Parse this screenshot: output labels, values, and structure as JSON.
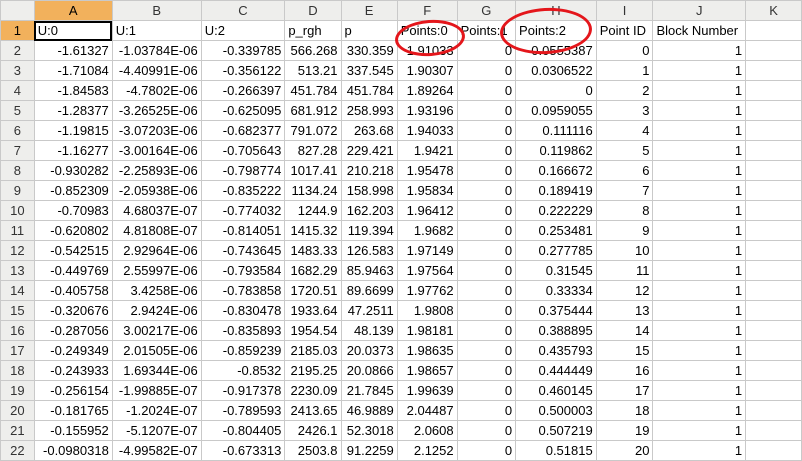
{
  "columns": [
    "A",
    "B",
    "C",
    "D",
    "E",
    "F",
    "G",
    "H",
    "I",
    "J",
    "K"
  ],
  "active_column": "A",
  "active_row": "1",
  "rows": [
    {
      "n": "1",
      "cells": [
        "U:0",
        "U:1",
        "U:2",
        "p_rgh",
        "p",
        "Points:0",
        "Points:1",
        "Points:2",
        "Point ID",
        "Block Number",
        ""
      ]
    },
    {
      "n": "2",
      "cells": [
        "-1.61327",
        "-1.03784E-06",
        "-0.339785",
        "566.268",
        "330.359",
        "1.91033",
        "0",
        "0.0555387",
        "0",
        "1",
        ""
      ]
    },
    {
      "n": "3",
      "cells": [
        "-1.71084",
        "-4.40991E-06",
        "-0.356122",
        "513.21",
        "337.545",
        "1.90307",
        "0",
        "0.0306522",
        "1",
        "1",
        ""
      ]
    },
    {
      "n": "4",
      "cells": [
        "-1.84583",
        "-4.7802E-06",
        "-0.266397",
        "451.784",
        "451.784",
        "1.89264",
        "0",
        "0",
        "2",
        "1",
        ""
      ]
    },
    {
      "n": "5",
      "cells": [
        "-1.28377",
        "-3.26525E-06",
        "-0.625095",
        "681.912",
        "258.993",
        "1.93196",
        "0",
        "0.0959055",
        "3",
        "1",
        ""
      ]
    },
    {
      "n": "6",
      "cells": [
        "-1.19815",
        "-3.07203E-06",
        "-0.682377",
        "791.072",
        "263.68",
        "1.94033",
        "0",
        "0.111116",
        "4",
        "1",
        ""
      ]
    },
    {
      "n": "7",
      "cells": [
        "-1.16277",
        "-3.00164E-06",
        "-0.705643",
        "827.28",
        "229.421",
        "1.9421",
        "0",
        "0.119862",
        "5",
        "1",
        ""
      ]
    },
    {
      "n": "8",
      "cells": [
        "-0.930282",
        "-2.25893E-06",
        "-0.798774",
        "1017.41",
        "210.218",
        "1.95478",
        "0",
        "0.166672",
        "6",
        "1",
        ""
      ]
    },
    {
      "n": "9",
      "cells": [
        "-0.852309",
        "-2.05938E-06",
        "-0.835222",
        "1134.24",
        "158.998",
        "1.95834",
        "0",
        "0.189419",
        "7",
        "1",
        ""
      ]
    },
    {
      "n": "10",
      "cells": [
        "-0.70983",
        "4.68037E-07",
        "-0.774032",
        "1244.9",
        "162.203",
        "1.96412",
        "0",
        "0.222229",
        "8",
        "1",
        ""
      ]
    },
    {
      "n": "11",
      "cells": [
        "-0.620802",
        "4.81808E-07",
        "-0.814051",
        "1415.32",
        "119.394",
        "1.9682",
        "0",
        "0.253481",
        "9",
        "1",
        ""
      ]
    },
    {
      "n": "12",
      "cells": [
        "-0.542515",
        "2.92964E-06",
        "-0.743645",
        "1483.33",
        "126.583",
        "1.97149",
        "0",
        "0.277785",
        "10",
        "1",
        ""
      ]
    },
    {
      "n": "13",
      "cells": [
        "-0.449769",
        "2.55997E-06",
        "-0.793584",
        "1682.29",
        "85.9463",
        "1.97564",
        "0",
        "0.31545",
        "11",
        "1",
        ""
      ]
    },
    {
      "n": "14",
      "cells": [
        "-0.405758",
        "3.4258E-06",
        "-0.783858",
        "1720.51",
        "89.6699",
        "1.97762",
        "0",
        "0.33334",
        "12",
        "1",
        ""
      ]
    },
    {
      "n": "15",
      "cells": [
        "-0.320676",
        "2.9424E-06",
        "-0.830478",
        "1933.64",
        "47.2511",
        "1.9808",
        "0",
        "0.375444",
        "13",
        "1",
        ""
      ]
    },
    {
      "n": "16",
      "cells": [
        "-0.287056",
        "3.00217E-06",
        "-0.835893",
        "1954.54",
        "48.139",
        "1.98181",
        "0",
        "0.388895",
        "14",
        "1",
        ""
      ]
    },
    {
      "n": "17",
      "cells": [
        "-0.249349",
        "2.01505E-06",
        "-0.859239",
        "2185.03",
        "20.0373",
        "1.98635",
        "0",
        "0.435793",
        "15",
        "1",
        ""
      ]
    },
    {
      "n": "18",
      "cells": [
        "-0.243933",
        "1.69344E-06",
        "-0.8532",
        "2195.25",
        "20.0866",
        "1.98657",
        "0",
        "0.444449",
        "16",
        "1",
        ""
      ]
    },
    {
      "n": "19",
      "cells": [
        "-0.256154",
        "-1.99885E-07",
        "-0.917378",
        "2230.09",
        "21.7845",
        "1.99639",
        "0",
        "0.460145",
        "17",
        "1",
        ""
      ]
    },
    {
      "n": "20",
      "cells": [
        "-0.181765",
        "-1.2024E-07",
        "-0.789593",
        "2413.65",
        "46.9889",
        "2.04487",
        "0",
        "0.500003",
        "18",
        "1",
        ""
      ]
    },
    {
      "n": "21",
      "cells": [
        "-0.155952",
        "-5.1207E-07",
        "-0.804405",
        "2426.1",
        "52.3018",
        "2.0608",
        "0",
        "0.507219",
        "19",
        "1",
        ""
      ]
    },
    {
      "n": "22",
      "cells": [
        "-0.0980318",
        "-4.99582E-07",
        "-0.673313",
        "2503.8",
        "91.2259",
        "2.1252",
        "0",
        "0.51815",
        "20",
        "1",
        ""
      ]
    }
  ],
  "annotation_color": "#e4161b"
}
